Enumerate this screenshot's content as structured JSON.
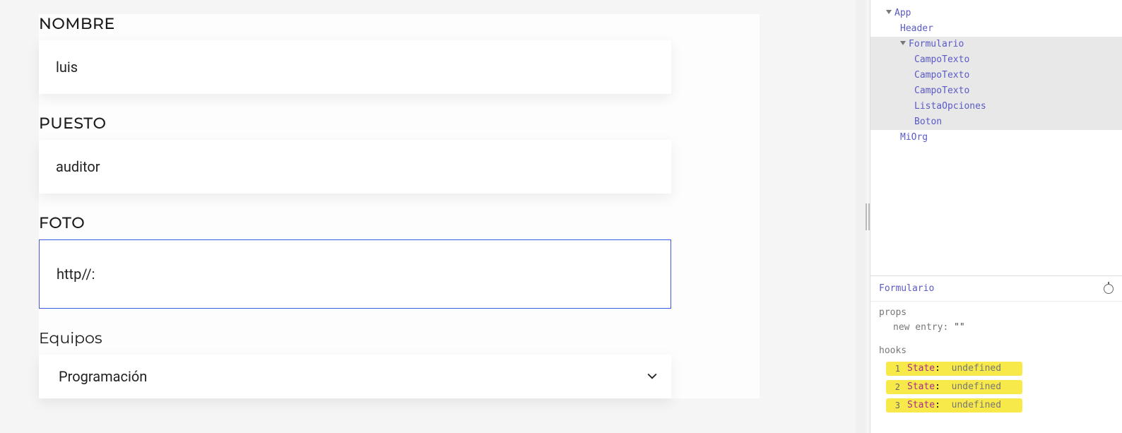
{
  "form": {
    "fields": [
      {
        "label": "NOMBRE",
        "value": "luis"
      },
      {
        "label": "PUESTO",
        "value": "auditor"
      },
      {
        "label": "FOTO",
        "value": "http//:"
      }
    ],
    "select": {
      "label": "Equipos",
      "value": "Programación"
    }
  },
  "devtools": {
    "tree": {
      "root": "App",
      "children": [
        {
          "name": "Header",
          "level": 2
        },
        {
          "name": "Formulario",
          "level": 2,
          "expanded": true,
          "selected": true,
          "children": [
            "CampoTexto",
            "CampoTexto",
            "CampoTexto",
            "ListaOpciones",
            "Boton"
          ]
        },
        {
          "name": "MiOrg",
          "level": 2
        }
      ]
    },
    "details": {
      "component": "Formulario",
      "props": {
        "new_entry_label": "new entry",
        "new_entry_value": "\"\""
      },
      "hooks_label": "hooks",
      "props_label": "props",
      "hooks": [
        {
          "n": "1",
          "key": "State",
          "value": "undefined"
        },
        {
          "n": "2",
          "key": "State",
          "value": "undefined"
        },
        {
          "n": "3",
          "key": "State",
          "value": "undefined"
        }
      ]
    }
  }
}
